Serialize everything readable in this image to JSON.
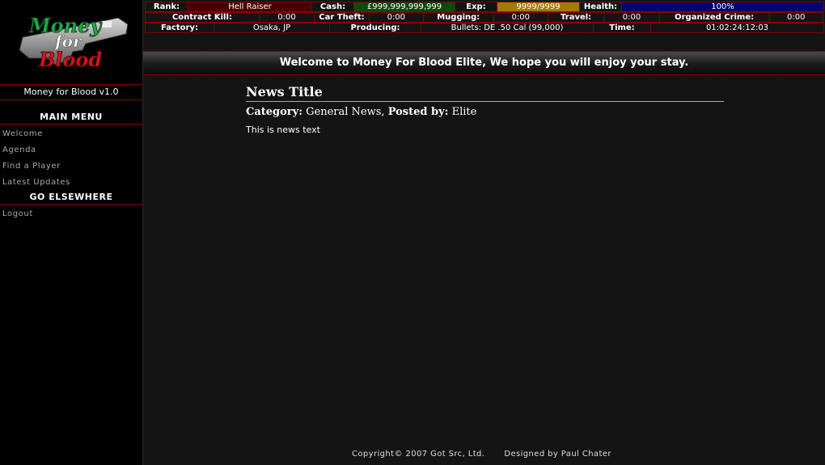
{
  "logo": {
    "line1": "Money",
    "line2": "for",
    "line3": "Blood"
  },
  "sidebar": {
    "version": "Money for Blood v1.0",
    "main_menu_heading": "MAIN MENU",
    "main_menu": [
      {
        "label": "Welcome"
      },
      {
        "label": "Agenda"
      },
      {
        "label": "Find a Player"
      },
      {
        "label": "Latest Updates"
      }
    ],
    "elsewhere_heading": "GO ELSEWHERE",
    "elsewhere": [
      {
        "label": "Logout"
      }
    ]
  },
  "stats": {
    "rank_label": "Rank:",
    "rank": "Hell Raiser",
    "cash_label": "Cash:",
    "cash": "£999,999,999,999",
    "exp_label": "Exp:",
    "exp": "9999/9999",
    "health_label": "Health:",
    "health": "100%",
    "contract_kill_label": "Contract Kill:",
    "contract_kill": "0:00",
    "car_theft_label": "Car Theft:",
    "car_theft": "0:00",
    "mugging_label": "Mugging:",
    "mugging": "0:00",
    "travel_label": "Travel:",
    "travel": "0:00",
    "organized_crime_label": "Organized Crime:",
    "organized_crime": "0:00",
    "factory_label": "Factory:",
    "factory": "Osaka, JP",
    "producing_label": "Producing:",
    "producing": "Bullets: DE .50 Cal (99,000)",
    "time_label": "Time:",
    "time": "01:02:24:12:03"
  },
  "welcome": "Welcome to Money For Blood Elite, We hope you will enjoy your stay.",
  "news": {
    "title": "News Title",
    "category_label": "Category:",
    "category": "General News,",
    "posted_label": "Posted by:",
    "author": "Elite",
    "text": "This is news text"
  },
  "footer": {
    "copyright": "Copyright© 2007 Got Src, Ltd.",
    "designer": "Designed by Paul Chater"
  },
  "colors": {
    "accent_red": "#8a0000",
    "cash_green": "#0d4a0d",
    "exp_gold": "#a37a00",
    "health_blue": "#00006e"
  }
}
